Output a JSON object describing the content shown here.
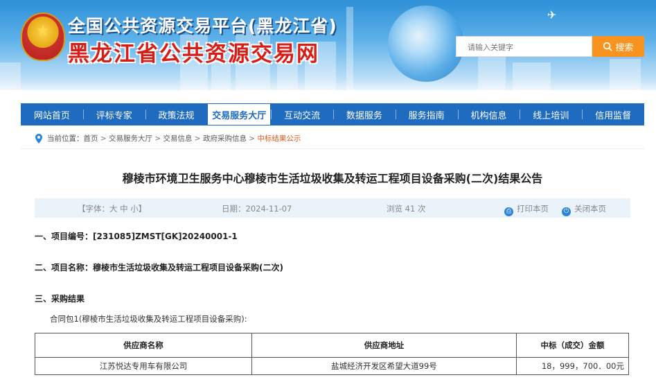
{
  "header": {
    "title_cn": "全国公共资源交易平台(黑龙江省)",
    "title_main": "黑龙江省公共资源交易网",
    "search_placeholder": "请输入关键字",
    "search_button": "搜索"
  },
  "nav": {
    "items": [
      "网站首页",
      "评标专家",
      "政策法规",
      "交易服务大厅",
      "互动交流",
      "数据服务",
      "服务指南",
      "机构信息",
      "线上培训",
      "信用监督"
    ],
    "active_index": 3
  },
  "breadcrumb": {
    "label": "当前位置：",
    "items": [
      "首页",
      "交易服务大厅",
      "交易信息",
      "政府采购信息",
      "中标结果公示"
    ],
    "separator": " > "
  },
  "article": {
    "title": "穆棱市环境卫生服务中心穆棱市生活垃圾收集及转运工程项目设备采购(二次)结果公告",
    "font_size_label": "【字体：大 中 小】",
    "date": "日期：2024-11-07",
    "views": "浏览 41 次",
    "print": "打印本页",
    "close": "关闭本页",
    "section1": "一、项目编号：[231085]ZMST[GK]20240001-1",
    "section2": "二、项目名称：穆棱市生活垃圾收集及转运工程项目设备采购(二次)",
    "section3": "三、采购结果",
    "contract_pkg": "合同包1(穆棱市生活垃圾收集及转运工程项目设备采购):",
    "table": {
      "headers": [
        "供应商名称",
        "供应商地址",
        "中标（成交）金额"
      ],
      "rows": [
        [
          "江苏悦达专用车有限公司",
          "盐城经济开发区希望大道99号",
          "18，999，700．00元"
        ]
      ]
    }
  },
  "colors": {
    "nav_bg": "#1e6bbf",
    "accent_orange": "#f7931e",
    "title_red": "#d71d16",
    "breadcrumb_current": "#e55a1c"
  },
  "icons": [
    "location-pin-icon",
    "search-icon",
    "print-icon",
    "power-icon",
    "plane-icon",
    "emblem-icon"
  ]
}
